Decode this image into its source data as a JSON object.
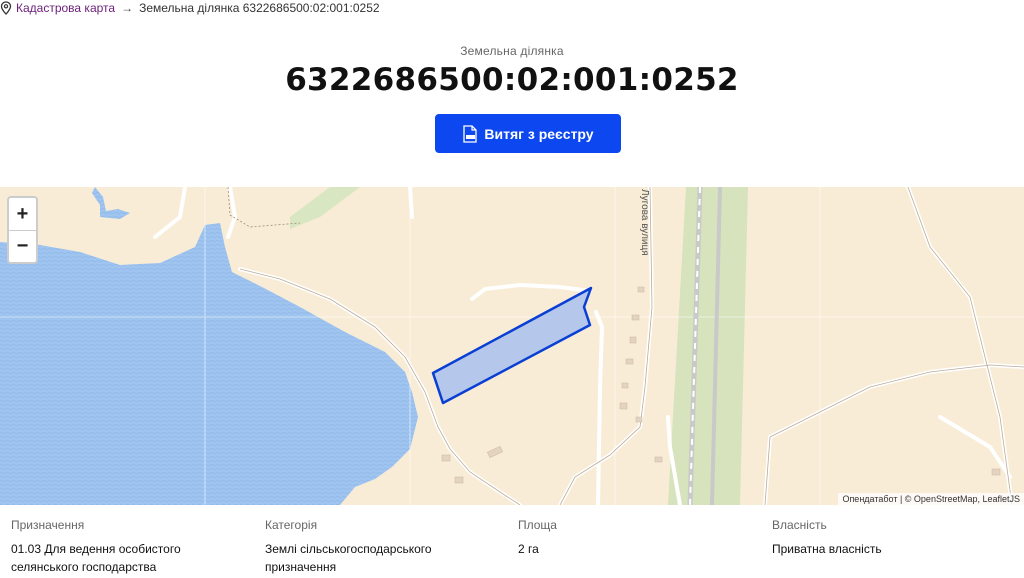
{
  "breadcrumb": {
    "home_label": "Кадастрова карта",
    "separator": "→",
    "current": "Земельна ділянка 6322686500:02:001:0252",
    "icon": "map-pin-icon"
  },
  "header": {
    "subtitle": "Земельна ділянка",
    "title": "6322686500:02:001:0252"
  },
  "pdf_button": {
    "label": "Витяг з реєстру",
    "icon": "pdf-file-icon",
    "color": "#0d47f0"
  },
  "map": {
    "zoom_in": "+",
    "zoom_out": "−",
    "street_label": "Лугова вулиця",
    "attribution": "Опендатабот | © OpenStreetMap, LeafletJS",
    "colors": {
      "land": "#f8ecd6",
      "water": "#9fc4f0",
      "parcel_fill": "#a9c1ee",
      "parcel_stroke": "#0a3fd4",
      "road": "#ffffff",
      "green": "#d9e6c2"
    }
  },
  "info": {
    "purpose": {
      "label": "Призначення",
      "value": "01.03 Для ведення особистого селянського господарства"
    },
    "category": {
      "label": "Категорія",
      "value": "Землі сільськогосподарського призначення"
    },
    "area": {
      "label": "Площа",
      "value": "2 га"
    },
    "ownership": {
      "label": "Власність",
      "value": "Приватна власність"
    }
  }
}
